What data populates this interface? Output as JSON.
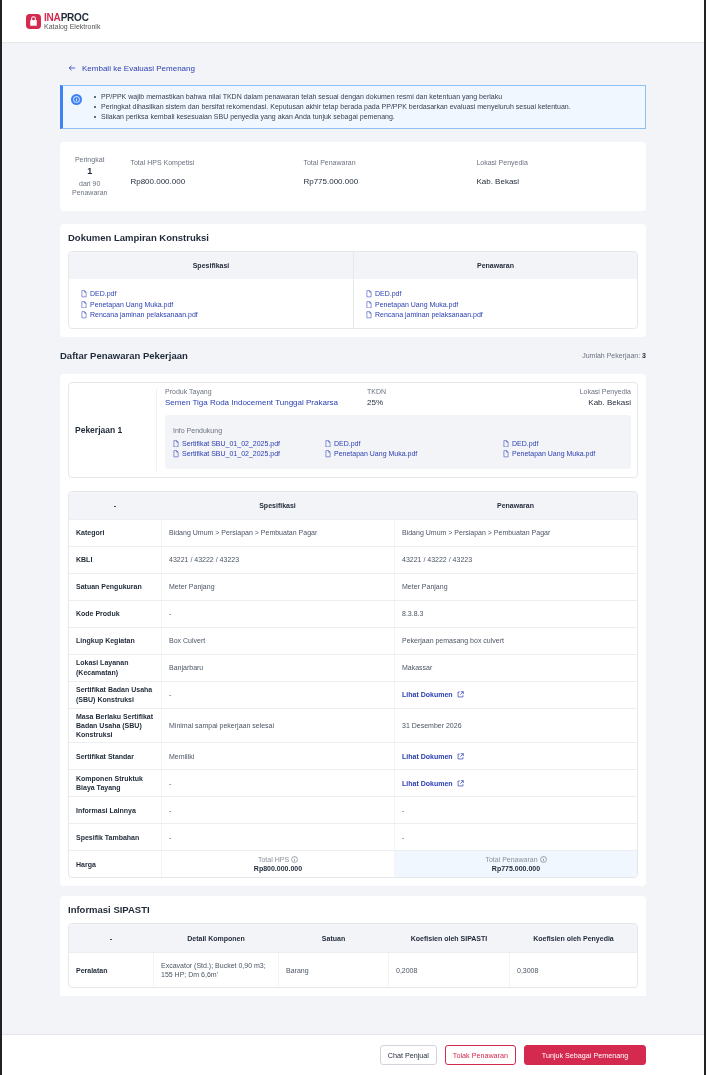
{
  "header": {
    "logo_text": "INAPROC",
    "logo_subtitle": "Katalog Elektronik"
  },
  "back_link": "Kembali ke Evaluasi Pemenang",
  "notice": {
    "items": [
      "PP/PPK wajib memastikan bahwa nilai TKDN dalam penawaran telah sesuai dengan dokumen resmi dan ketentuan yang berlaku",
      "Peringkat dihasilkan sistem dan bersifat rekomendasi. Keputusan akhir tetap berada pada PP/PPK berdasarkan evaluasi menyeluruh sesuai ketentuan.",
      "Silakan periksa kembali kesesuaian SBU penyedia yang akan Anda tunjuk sebagai pemenang."
    ]
  },
  "summary": {
    "rank_label": "Peringkat",
    "rank": "1",
    "rank_of": "dari 90",
    "rank_unit": "Penawaran",
    "stats": [
      {
        "label": "Total HPS Kompetisi",
        "value": "Rp800.000.000"
      },
      {
        "label": "Total Penawaran",
        "value": "Rp775.000.000"
      },
      {
        "label": "Lokasi Penyedia",
        "value": "Kab. Bekasi"
      }
    ]
  },
  "documents": {
    "title": "Dokumen Lampiran Konstruksi",
    "columns": [
      {
        "heading": "Spesifikasi",
        "files": [
          "DED.pdf",
          "Penetapan Uang Muka.pdf",
          "Rencana jaminan pelaksanaan.pdf"
        ]
      },
      {
        "heading": "Penawaran",
        "files": [
          "DED.pdf",
          "Penetapan Uang Muka.pdf",
          "Rencana jaminan pelaksanaan.pdf"
        ]
      }
    ]
  },
  "jobs": {
    "title": "Daftar Penawaran Pekerjaan",
    "count_label": "Jumlah Pekerjaan:",
    "count": "3",
    "items": [
      {
        "name": "Pekerjaan 1",
        "product_label": "Produk Tayang",
        "product": "Semen Tiga Roda Indocement Tunggal Prakarsa",
        "tkdn_label": "TKDN",
        "tkdn": "25%",
        "location_label": "Lokasi Penyedia",
        "location": "Kab. Bekasi",
        "support_label": "Info Pendukung",
        "support_files": [
          "Sertifikat SBU_01_02_2025.pdf",
          "DED.pdf",
          "DED.pdf",
          "Sertifikat SBU_01_02_2025.pdf",
          "Penetapan Uang Muka.pdf",
          "Penetapan Uang Muka.pdf"
        ]
      }
    ]
  },
  "spec_table": {
    "columns": [
      "-",
      "Spesifikasi",
      "Penawaran"
    ],
    "rows": [
      {
        "label": "Kategori",
        "kind": "text",
        "cells": [
          "Bidang Umum > Persiapan > Pembuatan Pagar",
          "Bidang Umum > Persiapan > Pembuatan Pagar"
        ]
      },
      {
        "label": "KBLI",
        "kind": "text",
        "cells": [
          "43221 / 43222 / 43223",
          "43221 / 43222 / 43223"
        ]
      },
      {
        "label": "Satuan Pengukuran",
        "kind": "text",
        "cells": [
          "Meter Panjang",
          "Meter Panjang"
        ]
      },
      {
        "label": "Kode Produk",
        "kind": "text",
        "cells": [
          "-",
          "8.3.8.3"
        ]
      },
      {
        "label": "Lingkup Kegiatan",
        "kind": "text",
        "cells": [
          "Box Culvert",
          "Pekerjaan pemasang box culvert"
        ]
      },
      {
        "label": "Lokasi Layanan (Kecamatan)",
        "kind": "text",
        "cells": [
          "Banjarbaru",
          "Makassar"
        ]
      },
      {
        "label": "Sertifikat Badan Usaha (SBU) Konstruksi",
        "kind": "link",
        "cells": [
          "-",
          "Lihat Dokumen"
        ]
      },
      {
        "label": "Masa Berlaku Sertifikat Badan Usaha (SBU) Konstruksi",
        "kind": "text",
        "cells": [
          "Minimal sampai pekerjaan selesai",
          "31 Desember 2026"
        ]
      },
      {
        "label": "Sertifikat Standar",
        "kind": "link",
        "cells": [
          "Memiliki",
          "Lihat Dokumen"
        ]
      },
      {
        "label": "Komponen Struktuk Biaya Tayang",
        "kind": "link",
        "cells": [
          "-",
          "Lihat Dokumen"
        ]
      },
      {
        "label": "Informasi Lainnya",
        "kind": "text",
        "cells": [
          "-",
          "-"
        ]
      },
      {
        "label": "Spesifik Tambahan",
        "kind": "text",
        "cells": [
          "-",
          "-"
        ]
      },
      {
        "label": "Harga",
        "kind": "price",
        "cells": [
          "Rp800.000.000",
          "Rp775.000.000"
        ],
        "cell_labels": [
          "Total HPS",
          "Total Penawaran"
        ]
      }
    ]
  },
  "sipasti": {
    "title": "Informasi SIPASTI",
    "columns": [
      "-",
      "Detail Komponen",
      "Satuan",
      "Koefisien oleh SIPASTI",
      "Koefisien oleh Penyedia"
    ],
    "rows": [
      {
        "cells": [
          "Peralatan",
          "Excavator (Std.); Bucket 0,90 m3; 155 HP; Dm 6,6m'",
          "Barang",
          "0,2008",
          "0,3008"
        ]
      }
    ]
  },
  "footer": {
    "buttons": [
      {
        "label": "Chat Penjual",
        "kind": "outline"
      },
      {
        "label": "Tolak Penawaran",
        "kind": "danger-outline"
      },
      {
        "label": "Tunjuk Sebagai Pemenang",
        "kind": "primary"
      }
    ]
  }
}
